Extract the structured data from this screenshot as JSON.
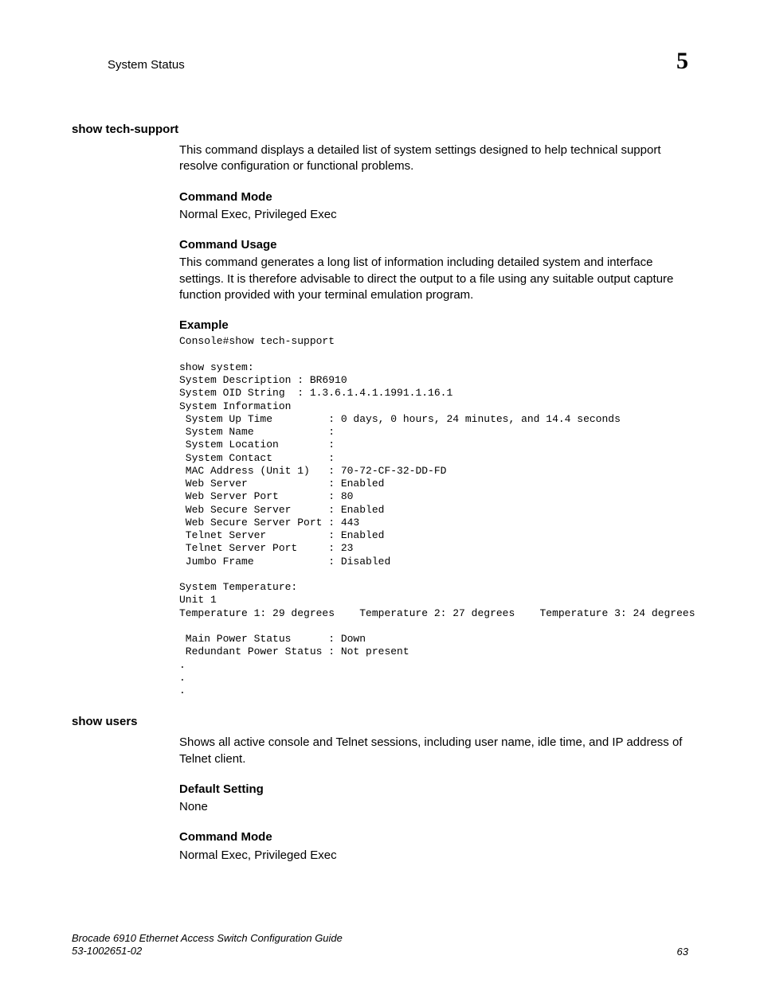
{
  "header": {
    "section_title": "System Status",
    "chapter_number": "5"
  },
  "sections": {
    "tech_support": {
      "heading": "show tech-support",
      "intro": "This command displays a detailed list of system settings designed to help technical support resolve configuration or functional problems.",
      "command_mode_label": "Command Mode",
      "command_mode_text": "Normal Exec, Privileged Exec",
      "command_usage_label": "Command Usage",
      "command_usage_text": "This command generates a long list of information including detailed system and interface settings. It is therefore advisable to direct the output to a file using any suitable output capture function provided with your terminal emulation program.",
      "example_label": "Example",
      "example_code": "Console#show tech-support\n\nshow system:\nSystem Description : BR6910\nSystem OID String  : 1.3.6.1.4.1.1991.1.16.1\nSystem Information\n System Up Time         : 0 days, 0 hours, 24 minutes, and 14.4 seconds\n System Name            :\n System Location        :\n System Contact         :\n MAC Address (Unit 1)   : 70-72-CF-32-DD-FD\n Web Server             : Enabled\n Web Server Port        : 80\n Web Secure Server      : Enabled\n Web Secure Server Port : 443\n Telnet Server          : Enabled\n Telnet Server Port     : 23\n Jumbo Frame            : Disabled\n\nSystem Temperature:\nUnit 1\nTemperature 1: 29 degrees    Temperature 2: 27 degrees    Temperature 3: 24 degrees\n\n Main Power Status      : Down\n Redundant Power Status : Not present\n.\n.\n."
    },
    "show_users": {
      "heading": "show users",
      "intro": "Shows all active console and Telnet sessions, including user name, idle time, and IP address of Telnet client.",
      "default_setting_label": "Default Setting",
      "default_setting_text": "None",
      "command_mode_label": "Command Mode",
      "command_mode_text": "Normal Exec, Privileged Exec"
    }
  },
  "footer": {
    "book_title": "Brocade 6910 Ethernet Access Switch Configuration Guide",
    "doc_number": "53-1002651-02",
    "page_number": "63"
  }
}
